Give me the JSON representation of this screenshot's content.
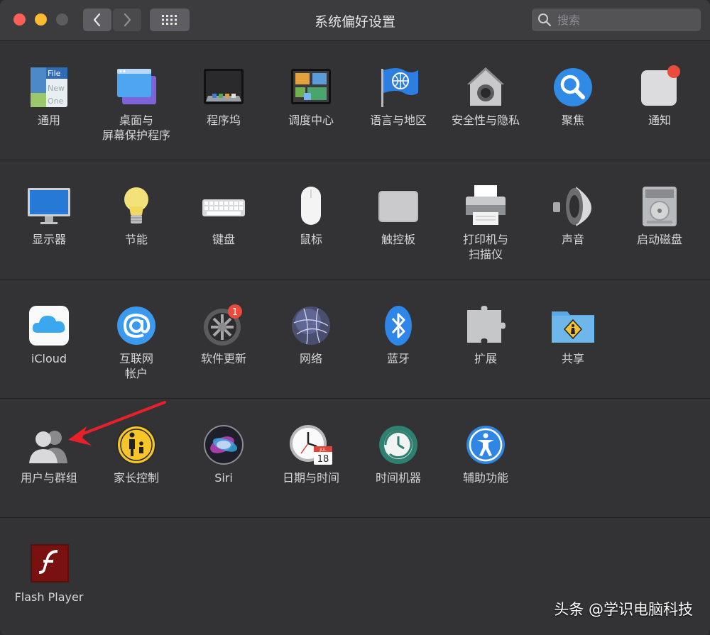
{
  "window": {
    "title": "系统偏好设置"
  },
  "search": {
    "placeholder": "搜索"
  },
  "rows": [
    [
      {
        "label": "通用",
        "icon": "general-icon"
      },
      {
        "label": "桌面与\n屏幕保护程序",
        "icon": "desktop-screensaver-icon"
      },
      {
        "label": "程序坞",
        "icon": "dock-icon"
      },
      {
        "label": "调度中心",
        "icon": "mission-control-icon"
      },
      {
        "label": "语言与地区",
        "icon": "language-region-icon"
      },
      {
        "label": "安全性与隐私",
        "icon": "security-privacy-icon"
      },
      {
        "label": "聚焦",
        "icon": "spotlight-icon"
      },
      {
        "label": "通知",
        "icon": "notifications-icon"
      }
    ],
    [
      {
        "label": "显示器",
        "icon": "displays-icon"
      },
      {
        "label": "节能",
        "icon": "energy-saver-icon"
      },
      {
        "label": "键盘",
        "icon": "keyboard-icon"
      },
      {
        "label": "鼠标",
        "icon": "mouse-icon"
      },
      {
        "label": "触控板",
        "icon": "trackpad-icon"
      },
      {
        "label": "打印机与\n扫描仪",
        "icon": "printers-scanners-icon"
      },
      {
        "label": "声音",
        "icon": "sound-icon"
      },
      {
        "label": "启动磁盘",
        "icon": "startup-disk-icon"
      }
    ],
    [
      {
        "label": "iCloud",
        "icon": "icloud-icon"
      },
      {
        "label": "互联网\n帐户",
        "icon": "internet-accounts-icon"
      },
      {
        "label": "软件更新",
        "icon": "software-update-icon",
        "badge": "1"
      },
      {
        "label": "网络",
        "icon": "network-icon"
      },
      {
        "label": "蓝牙",
        "icon": "bluetooth-icon"
      },
      {
        "label": "扩展",
        "icon": "extensions-icon"
      },
      {
        "label": "共享",
        "icon": "sharing-icon"
      }
    ],
    [
      {
        "label": "用户与群组",
        "icon": "users-groups-icon"
      },
      {
        "label": "家长控制",
        "icon": "parental-controls-icon"
      },
      {
        "label": "Siri",
        "icon": "siri-icon"
      },
      {
        "label": "日期与时间",
        "icon": "date-time-icon",
        "calendar_month": "JUL",
        "calendar_day": "18"
      },
      {
        "label": "时间机器",
        "icon": "time-machine-icon"
      },
      {
        "label": "辅助功能",
        "icon": "accessibility-icon"
      }
    ],
    [
      {
        "label": "Flash Player",
        "icon": "flash-player-icon"
      }
    ]
  ],
  "watermark": "头条 @学识电脑科技",
  "colors": {
    "arrow": "#e8202a",
    "badge": "#e94b3c"
  }
}
